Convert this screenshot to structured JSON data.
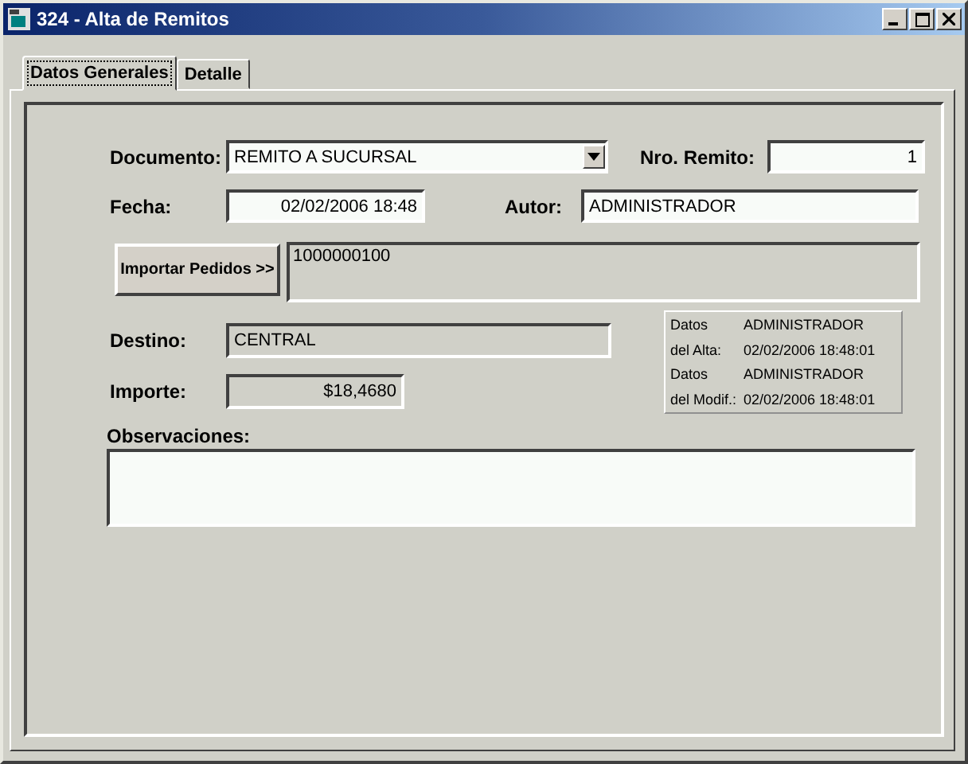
{
  "window": {
    "title": "324 - Alta de Remitos"
  },
  "tabs": [
    {
      "label": "Datos Generales",
      "selected": true
    },
    {
      "label": "Detalle",
      "selected": false
    }
  ],
  "documento": {
    "label": "Documento:",
    "value": "REMITO A SUCURSAL",
    "readonly": false
  },
  "nro_remito": {
    "label": "Nro. Remito:",
    "value": "1",
    "readonly": false
  },
  "fecha": {
    "label": "Fecha:",
    "value": "02/02/2006 18:48",
    "readonly": false
  },
  "autor": {
    "label": "Autor:",
    "value": "ADMINISTRADOR",
    "readonly": false
  },
  "importar_button": "Importar Pedidos >>",
  "pedidos": {
    "value": "1000000100",
    "readonly": true
  },
  "destino": {
    "label": "Destino:",
    "value": "CENTRAL",
    "readonly": true
  },
  "importe": {
    "label": "Importe:",
    "value": "$18,4680",
    "readonly": true
  },
  "audit": [
    {
      "label_1": "Datos",
      "label_2": "del Alta:",
      "user": "ADMINISTRADOR",
      "date": "02/02/2006 18:48:01"
    },
    {
      "label_1": "Datos",
      "label_2": "del Modif.:",
      "user": "ADMINISTRADOR",
      "date": "02/02/2006 18:48:01"
    }
  ],
  "observaciones": {
    "label": "Observaciones:",
    "readonly": false
  }
}
